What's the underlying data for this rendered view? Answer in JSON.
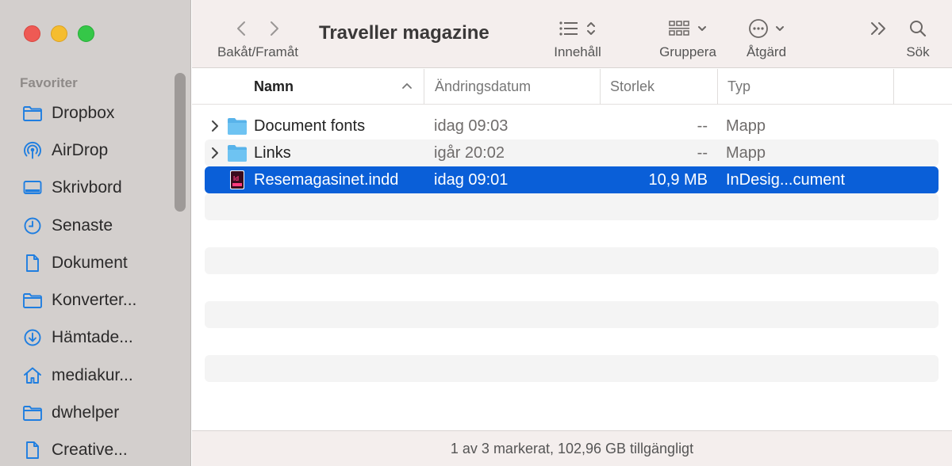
{
  "window": {
    "title": "Traveller magazine"
  },
  "toolbar": {
    "nav_label": "Bakåt/Framåt",
    "view_label": "Innehåll",
    "group_label": "Gruppera",
    "action_label": "Åtgärd",
    "search_label": "Sök"
  },
  "sidebar": {
    "section": "Favoriter",
    "items": [
      {
        "label": "Dropbox",
        "icon": "folder-icon"
      },
      {
        "label": "AirDrop",
        "icon": "airdrop-icon"
      },
      {
        "label": "Skrivbord",
        "icon": "desktop-icon"
      },
      {
        "label": "Senaste",
        "icon": "clock-icon"
      },
      {
        "label": "Dokument",
        "icon": "document-icon"
      },
      {
        "label": "Konverter...",
        "icon": "folder-icon"
      },
      {
        "label": "Hämtade...",
        "icon": "download-icon"
      },
      {
        "label": "mediakur...",
        "icon": "home-icon"
      },
      {
        "label": "dwhelper",
        "icon": "folder-icon"
      },
      {
        "label": "Creative...",
        "icon": "document-icon"
      }
    ]
  },
  "columns": {
    "name": "Namn",
    "date": "Ändringsdatum",
    "size": "Storlek",
    "type": "Typ"
  },
  "files": [
    {
      "name": "Document fonts",
      "date": "idag 09:03",
      "size": "--",
      "type": "Mapp",
      "kind": "folder",
      "selected": false
    },
    {
      "name": "Links",
      "date": "igår 20:02",
      "size": "--",
      "type": "Mapp",
      "kind": "folder",
      "selected": false
    },
    {
      "name": "Resemagasinet.indd",
      "date": "idag 09:01",
      "size": "10,9 MB",
      "type": "InDesig...cument",
      "kind": "indesign",
      "selected": true
    }
  ],
  "status": {
    "text": "1 av 3 markerat, 102,96 GB tillgängligt"
  },
  "colors": {
    "selection": "#0a5fd8",
    "sidebar_bg": "#d3cfcd",
    "toolbar_bg": "#f4eeed",
    "folder_blue": "#58b3ea"
  }
}
